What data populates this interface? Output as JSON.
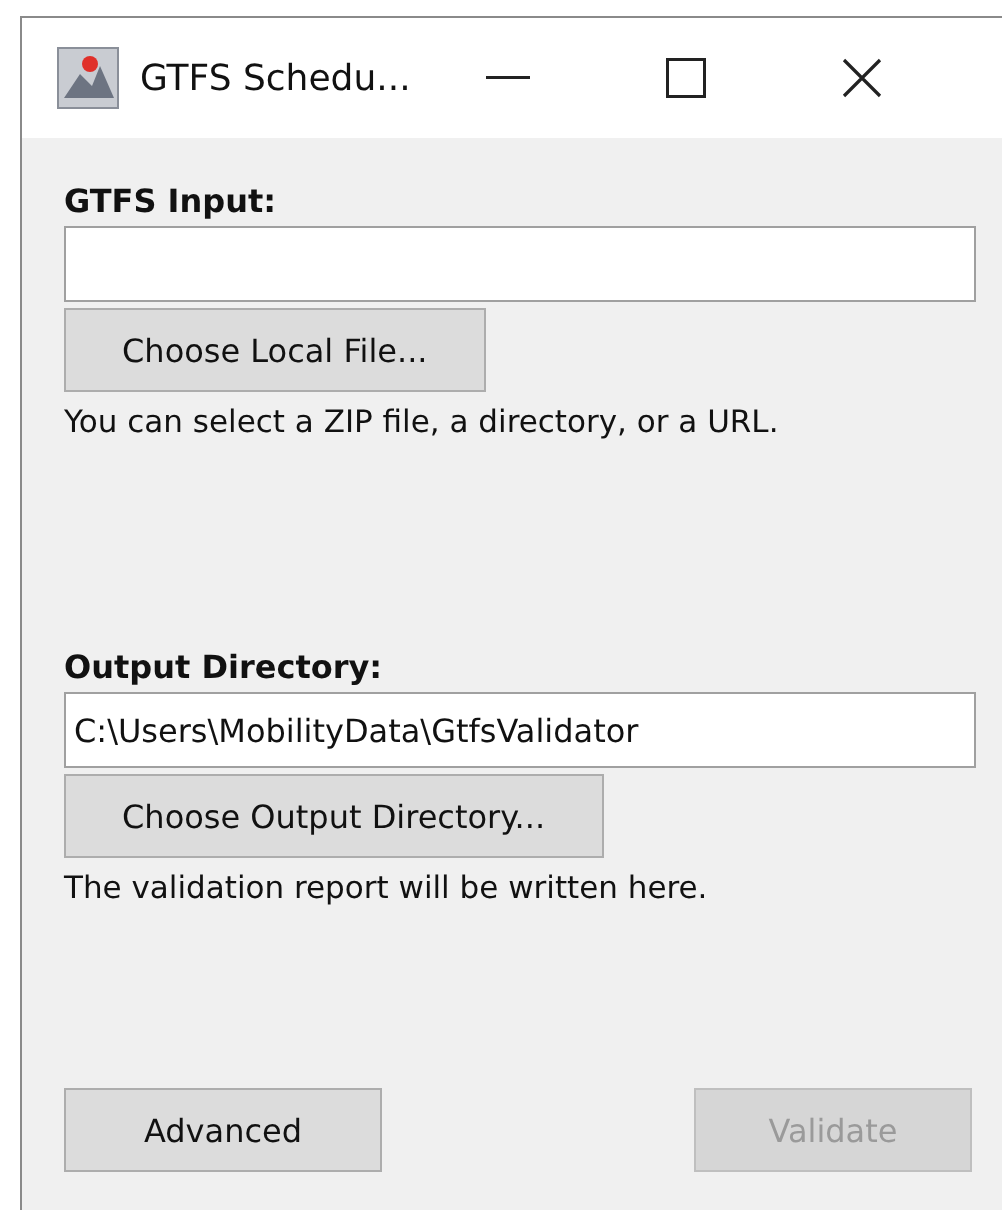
{
  "window": {
    "title": "GTFS Schedu..."
  },
  "input_section": {
    "label": "GTFS Input:",
    "button": {
      "label": "Choose Local File...",
      "disabled": false
    },
    "hint": "You can select a ZIP file, a directory, or a URL."
  },
  "output_section": {
    "label": "Output Directory:",
    "field": {
      "value": "C:\\Users\\MobilityData\\GtfsValidator"
    },
    "button": {
      "label": "Choose Output Directory...",
      "disabled": false
    },
    "hint": "The validation report will be written here."
  },
  "buttons": [
    {
      "label": "Advanced",
      "disabled": false
    },
    {
      "label": "Validate",
      "disabled": true
    }
  ]
}
